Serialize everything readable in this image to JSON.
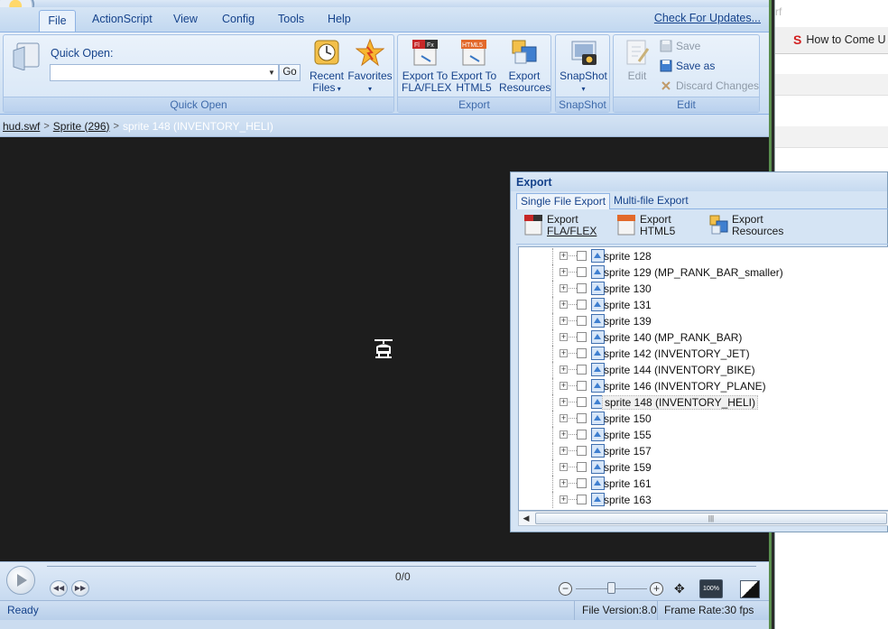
{
  "background_window": {
    "tab_label": "How to Come U",
    "tab_prefix_faint": "rf"
  },
  "ribbon": {
    "tabs": [
      "File",
      "ActionScript",
      "View",
      "Config",
      "Tools",
      "Help"
    ],
    "active_tab": "File",
    "check_updates": "Check For Updates...",
    "groups": {
      "quick_open": {
        "label": "Quick Open",
        "field_label": "Quick Open:",
        "input_value": "",
        "go_label": "Go",
        "recent_files_line1": "Recent",
        "recent_files_line2": "Files",
        "favorites_label": "Favorites"
      },
      "export": {
        "label": "Export",
        "fla_line1": "Export To",
        "fla_line2": "FLA/FLEX",
        "html5_line1": "Export To",
        "html5_line2": "HTML5",
        "resources_line1": "Export",
        "resources_line2": "Resources"
      },
      "snapshot": {
        "label": "SnapShot",
        "button_label": "SnapShot"
      },
      "edit": {
        "label": "Edit",
        "edit_label": "Edit",
        "save_label": "Save",
        "save_as_label": "Save as",
        "discard_label": "Discard Changes"
      }
    }
  },
  "breadcrumb": {
    "items": [
      "hud.swf",
      "Sprite (296)"
    ],
    "current": "sprite 148 (INVENTORY_HELI)"
  },
  "player": {
    "frame_counter": "0/0",
    "zoom_label": "100%"
  },
  "status_bar": {
    "status": "Ready",
    "file_version": "File Version:8.0",
    "frame_rate": "Frame Rate:30 fps"
  },
  "export_dialog": {
    "title": "Export",
    "tabs": [
      "Single File Export",
      "Multi-file Export"
    ],
    "active_tab": "Single File Export",
    "tools": [
      {
        "line1": "Export",
        "line2": "FLA/FLEX"
      },
      {
        "line1": "Export",
        "line2": "HTML5"
      },
      {
        "line1": "Export",
        "line2": "Resources"
      }
    ],
    "tree_items": [
      "sprite 128",
      "sprite 129 (MP_RANK_BAR_smaller)",
      "sprite 130",
      "sprite 131",
      "sprite 139",
      "sprite 140 (MP_RANK_BAR)",
      "sprite 142 (INVENTORY_JET)",
      "sprite 144 (INVENTORY_BIKE)",
      "sprite 146 (INVENTORY_PLANE)",
      "sprite 148 (INVENTORY_HELI)",
      "sprite 150",
      "sprite 155",
      "sprite 157",
      "sprite 159",
      "sprite 161",
      "sprite 163"
    ],
    "selected_item": "sprite 148 (INVENTORY_HELI)"
  },
  "colors": {
    "ribbon_text": "#15428b",
    "stage_background": "#1d1d1d",
    "dialog_background": "#d5e4f4"
  }
}
